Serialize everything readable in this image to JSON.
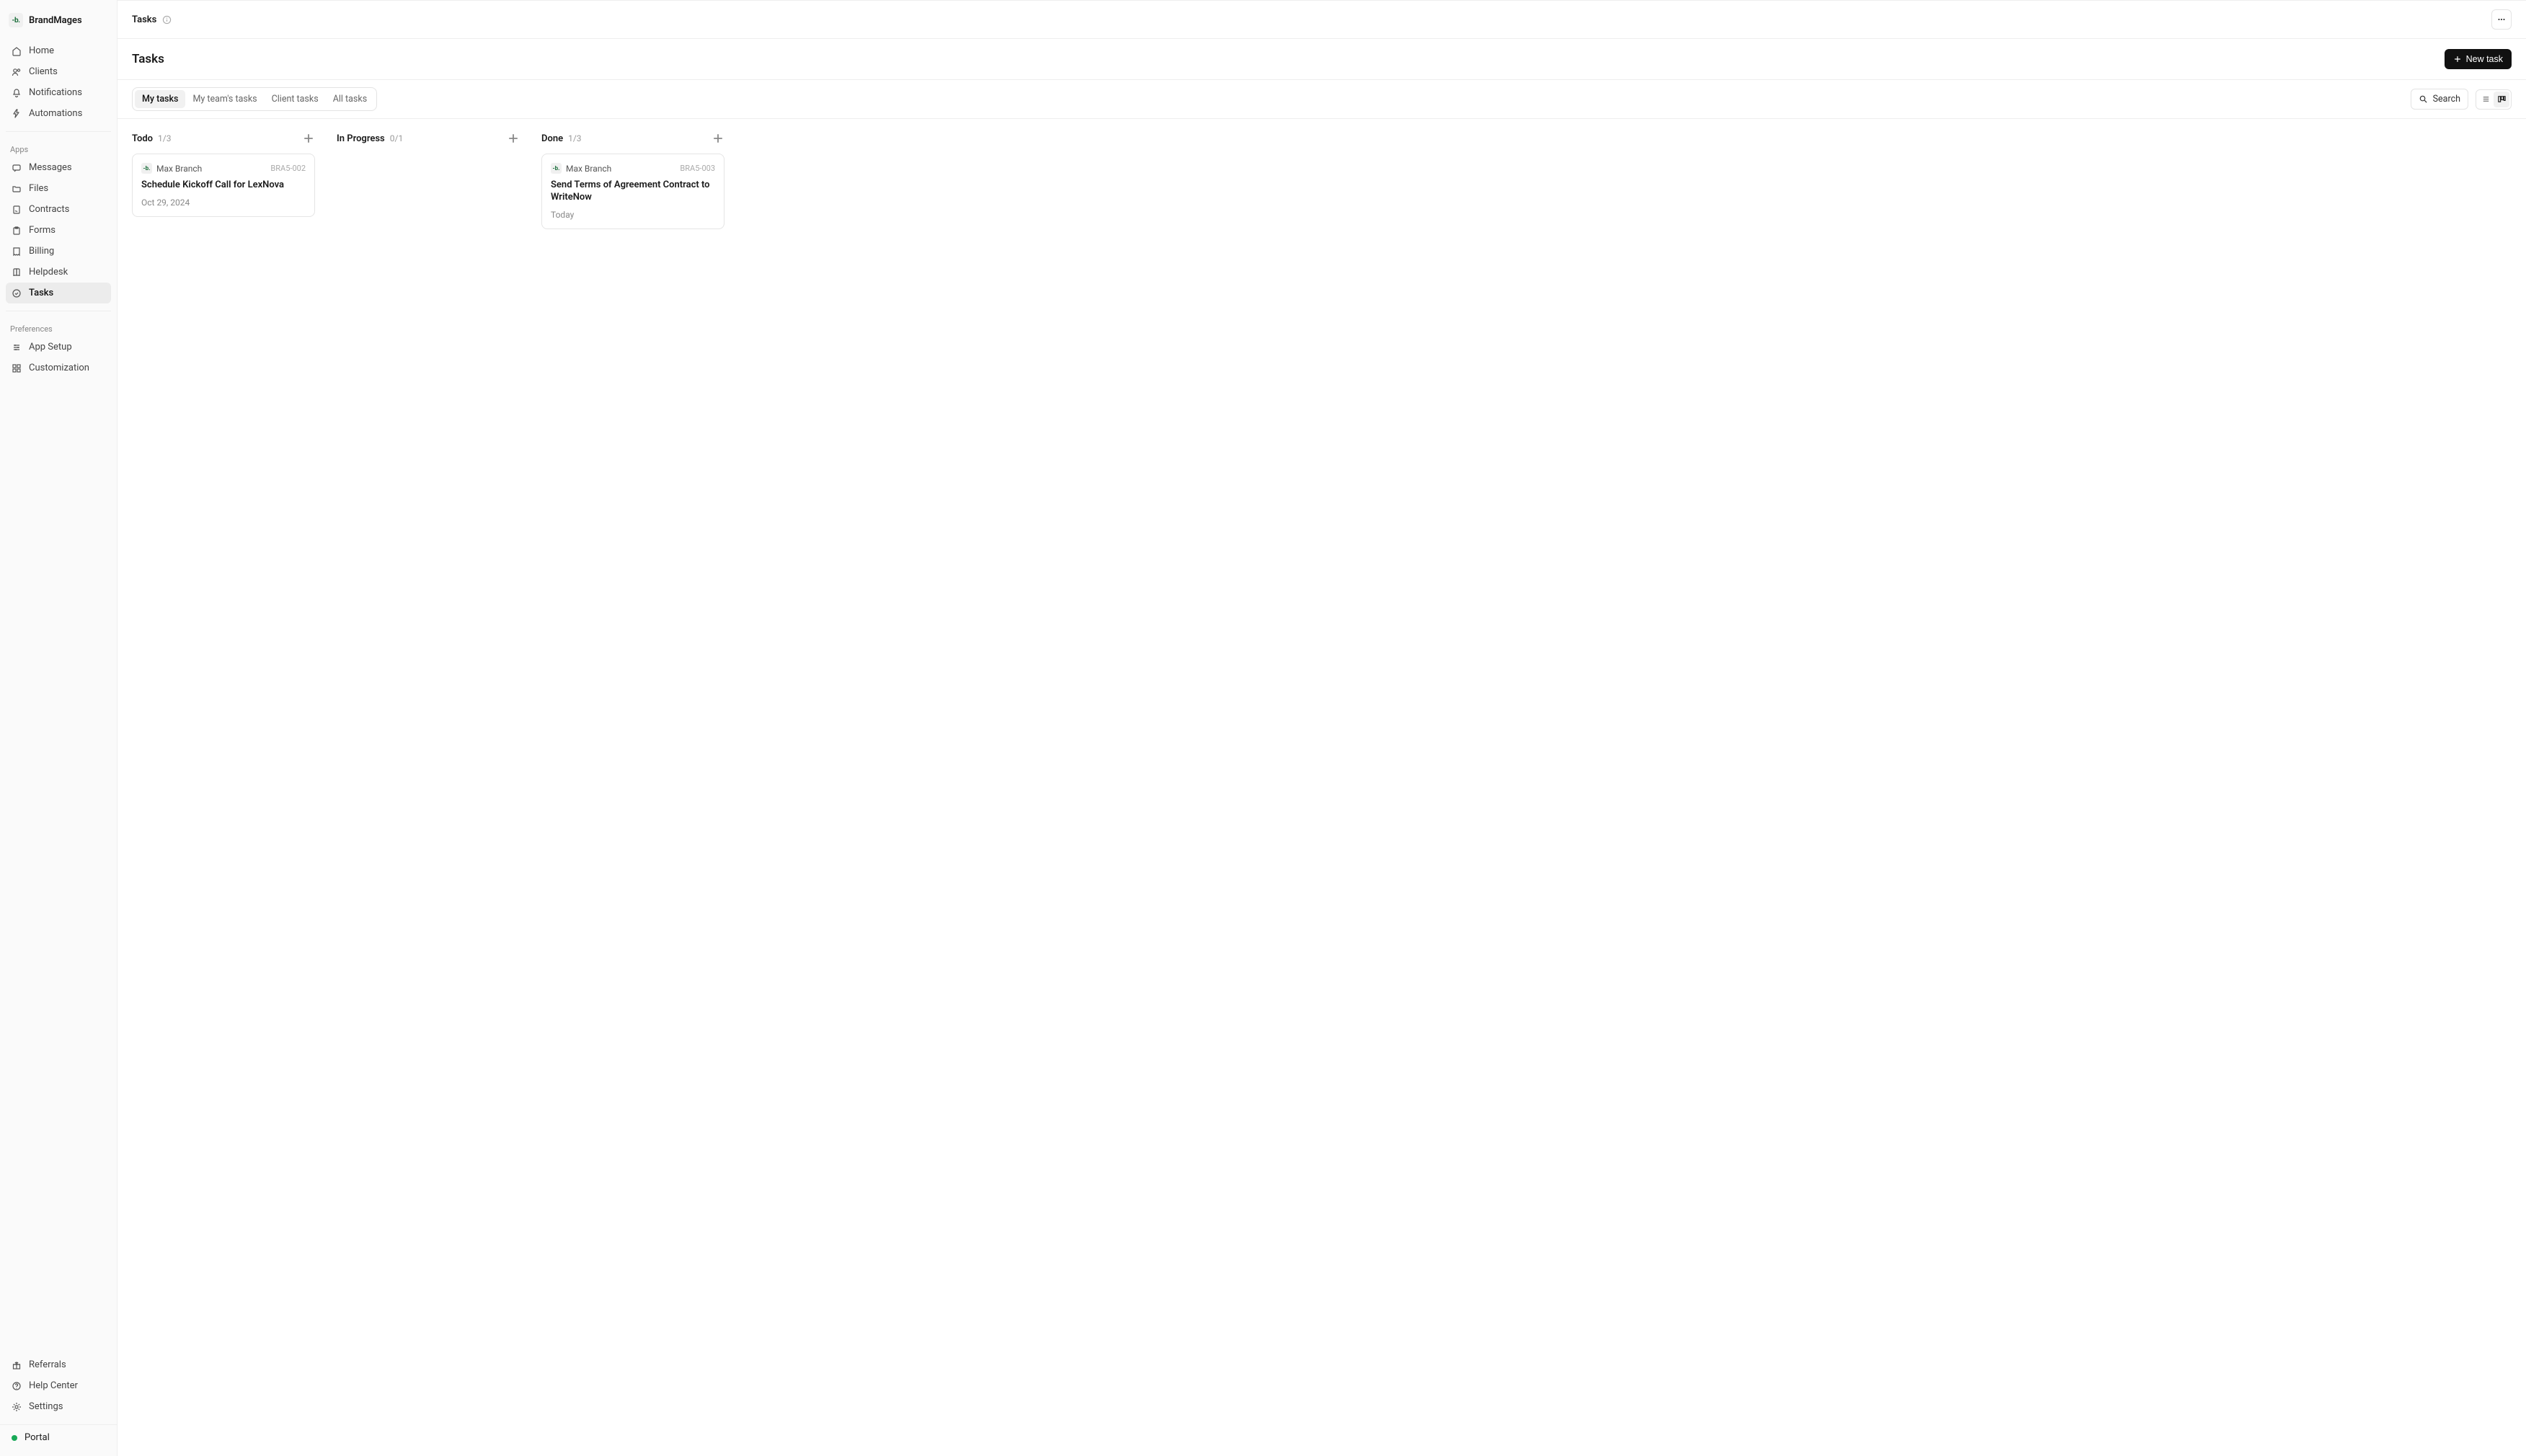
{
  "brand": {
    "logo_text": "-b.",
    "name": "BrandMages"
  },
  "nav": {
    "main": [
      {
        "label": "Home",
        "icon": "home"
      },
      {
        "label": "Clients",
        "icon": "users"
      },
      {
        "label": "Notifications",
        "icon": "bell"
      },
      {
        "label": "Automations",
        "icon": "zap"
      }
    ],
    "apps_label": "Apps",
    "apps": [
      {
        "label": "Messages",
        "icon": "message"
      },
      {
        "label": "Files",
        "icon": "folder"
      },
      {
        "label": "Contracts",
        "icon": "file-sig"
      },
      {
        "label": "Forms",
        "icon": "clipboard"
      },
      {
        "label": "Billing",
        "icon": "receipt"
      },
      {
        "label": "Helpdesk",
        "icon": "book"
      },
      {
        "label": "Tasks",
        "icon": "badge",
        "active": true
      }
    ],
    "prefs_label": "Preferences",
    "prefs": [
      {
        "label": "App Setup",
        "icon": "sliders"
      },
      {
        "label": "Customization",
        "icon": "grid"
      }
    ],
    "bottom": [
      {
        "label": "Referrals",
        "icon": "gift"
      },
      {
        "label": "Help Center",
        "icon": "help"
      },
      {
        "label": "Settings",
        "icon": "gear"
      }
    ],
    "portal_label": "Portal"
  },
  "topbar": {
    "title": "Tasks"
  },
  "header": {
    "page_title": "Tasks",
    "new_task_label": "New task"
  },
  "tabs": [
    {
      "label": "My tasks",
      "active": true
    },
    {
      "label": "My team's tasks"
    },
    {
      "label": "Client tasks"
    },
    {
      "label": "All tasks"
    }
  ],
  "search_label": "Search",
  "columns": [
    {
      "title": "Todo",
      "count": "1/3",
      "cards": [
        {
          "assignee": "Max Branch",
          "id": "BRA5-002",
          "title": "Schedule Kickoff Call for LexNova",
          "date": "Oct 29, 2024"
        }
      ]
    },
    {
      "title": "In Progress",
      "count": "0/1",
      "cards": []
    },
    {
      "title": "Done",
      "count": "1/3",
      "cards": [
        {
          "assignee": "Max Branch",
          "id": "BRA5-003",
          "title": "Send Terms of Agreement Contract to WriteNow",
          "date": "Today"
        }
      ]
    }
  ]
}
